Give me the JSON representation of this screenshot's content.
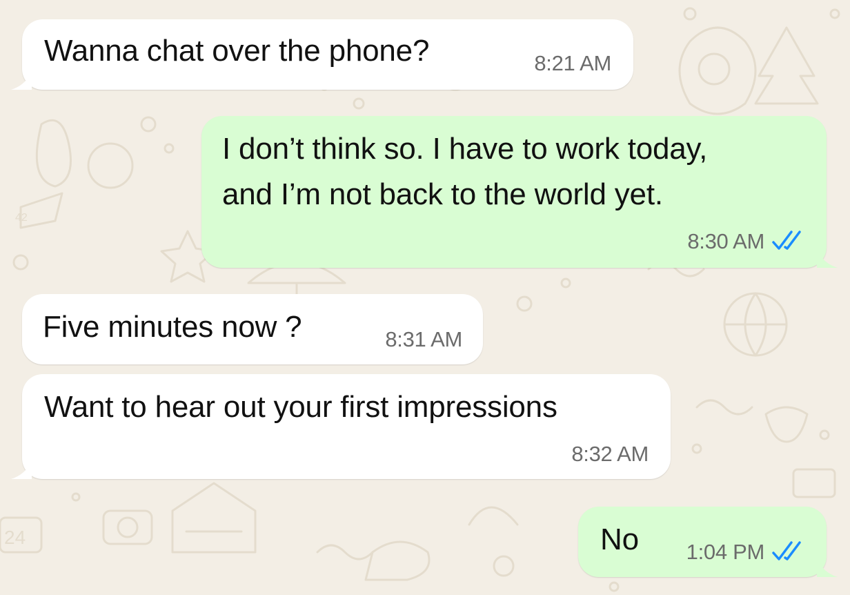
{
  "chat": {
    "messages": [
      {
        "direction": "incoming",
        "text_lines": [
          "Wanna chat over the phone?"
        ],
        "time": "8:21 AM"
      },
      {
        "direction": "outgoing",
        "text_lines": [
          "I don’t think so. I have to work today,",
          "and I’m not back to the world yet."
        ],
        "time": "8:30 AM",
        "status_icon": "double-check-read-icon"
      },
      {
        "direction": "incoming",
        "text_lines": [
          "Five minutes now ?"
        ],
        "time": "8:31 AM"
      },
      {
        "direction": "incoming",
        "text_lines": [
          "Want to hear out your first impressions"
        ],
        "time": "8:32 AM"
      },
      {
        "direction": "outgoing",
        "text_lines": [
          "No"
        ],
        "time": "1:04 PM",
        "status_icon": "double-check-read-icon"
      }
    ]
  },
  "colors": {
    "background": "#f3eee5",
    "incoming_bubble": "#ffffff",
    "outgoing_bubble": "#d9fdd3",
    "read_ticks": "#1a8cff",
    "timestamp": "#6b6b6b"
  }
}
